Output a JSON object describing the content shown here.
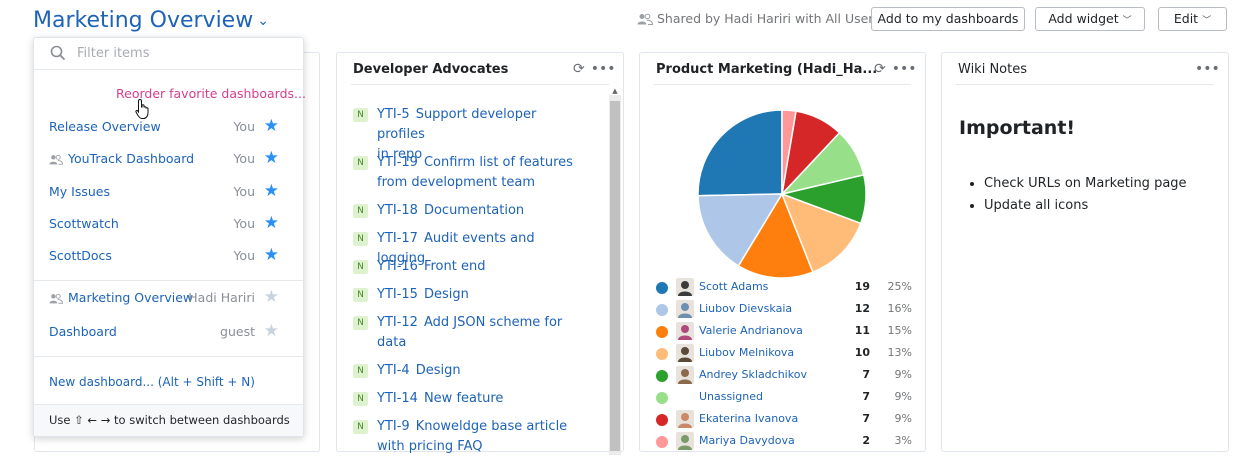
{
  "header": {
    "title": "Marketing Overview",
    "shared_text": "Shared by Hadi Hariri with All Users",
    "add_to_dashboards": "Add to my dashboards",
    "add_widget": "Add widget",
    "edit": "Edit"
  },
  "dropdown": {
    "filter_placeholder": "Filter items",
    "reorder_label": "Reorder favorite dashboards...",
    "items": [
      {
        "label": "Release Overview",
        "owner": "You",
        "favorite": true,
        "shared_icon": false
      },
      {
        "label": "YouTrack Dashboard",
        "owner": "You",
        "favorite": true,
        "shared_icon": true
      },
      {
        "label": "My Issues",
        "owner": "You",
        "favorite": true,
        "shared_icon": false
      },
      {
        "label": "Scottwatch",
        "owner": "You",
        "favorite": true,
        "shared_icon": false
      },
      {
        "label": "ScottDocs",
        "owner": "You",
        "favorite": true,
        "shared_icon": false
      }
    ],
    "other_items": [
      {
        "label": "Marketing Overview",
        "owner": "Hadi Hariri",
        "favorite": false,
        "shared_icon": true
      },
      {
        "label": "Dashboard",
        "owner": "guest",
        "favorite": false,
        "shared_icon": false
      }
    ],
    "new_dashboard": "New dashboard... (Alt + Shift + N)",
    "footer_hint": "Use ⇧ ← → to switch between dashboards"
  },
  "widgets": {
    "developer_advocates": {
      "title": "Developer Advocates",
      "issues": [
        {
          "badge": "N",
          "id": "YTI-5",
          "lines": [
            "Support developer profiles",
            "in repo"
          ]
        },
        {
          "badge": "N",
          "id": "YTI-19",
          "lines": [
            "Confirm list of features",
            "from development team"
          ]
        },
        {
          "badge": "N",
          "id": "YTI-18",
          "lines": [
            "Documentation"
          ]
        },
        {
          "badge": "N",
          "id": "YTI-17",
          "lines": [
            "Audit events and logging"
          ]
        },
        {
          "badge": "N",
          "id": "YTI-16",
          "lines": [
            "Front end"
          ]
        },
        {
          "badge": "N",
          "id": "YTI-15",
          "lines": [
            "Design"
          ]
        },
        {
          "badge": "N",
          "id": "YTI-12",
          "lines": [
            "Add JSON scheme for",
            "data"
          ]
        },
        {
          "badge": "N",
          "id": "YTI-4",
          "lines": [
            "Design"
          ]
        },
        {
          "badge": "N",
          "id": "YTI-14",
          "lines": [
            "New feature"
          ]
        },
        {
          "badge": "N",
          "id": "YTI-9",
          "lines": [
            "Knoweldge base article",
            "with pricing FAQ"
          ]
        }
      ]
    },
    "product_marketing": {
      "title": "Product Marketing (Hadi_Ha...",
      "chart_data": {
        "type": "pie",
        "labels": [
          "Scott Adams",
          "Liubov Dievskaia",
          "Valerie Andrianova",
          "Liubov Melnikova",
          "Andrey Skladchikov",
          "Unassigned",
          "Ekaterina Ivanova",
          "Mariya Davydova"
        ],
        "values": [
          19,
          12,
          11,
          10,
          7,
          7,
          7,
          2
        ],
        "percents": [
          "25%",
          "16%",
          "15%",
          "13%",
          "9%",
          "9%",
          "9%",
          "3%"
        ],
        "colors": [
          "#1f77b4",
          "#aec7e8",
          "#ff7f0e",
          "#ffbb78",
          "#2ca02c",
          "#98df8a",
          "#d62728",
          "#ff9896"
        ]
      }
    },
    "wiki": {
      "title": "Wiki Notes",
      "heading": "Important!",
      "bullets": [
        "Check URLs on Marketing page",
        "Update all icons"
      ]
    }
  }
}
